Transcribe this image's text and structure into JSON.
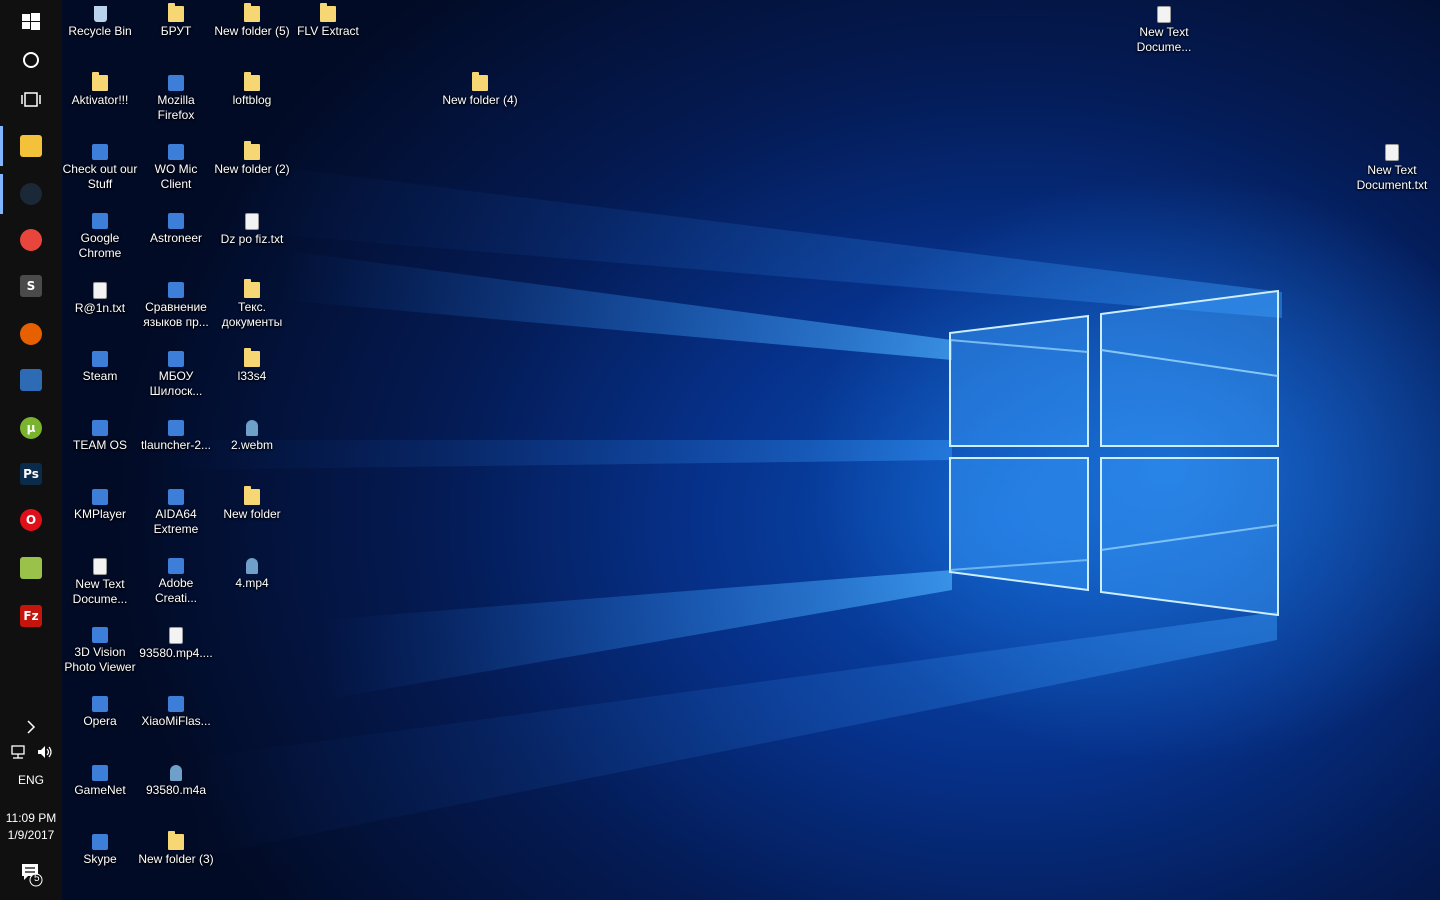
{
  "taskbar": {
    "start_icon": "windows-logo-icon",
    "search_icon": "cortana-circle-icon",
    "taskview_icon": "task-view-icon",
    "pinned": [
      {
        "name": "file-explorer",
        "icon": "folder-icon",
        "glyph": "",
        "color": "#f3c13a",
        "active": true
      },
      {
        "name": "steam",
        "icon": "steam-icon",
        "glyph": "",
        "color": "#1b2838",
        "active": true
      },
      {
        "name": "chrome",
        "icon": "chrome-icon",
        "glyph": "",
        "color": "#e8453c",
        "active": false
      },
      {
        "name": "sublime",
        "icon": "sublime-icon",
        "glyph": "S",
        "color": "#4a4a4a",
        "active": false
      },
      {
        "name": "firefox",
        "icon": "firefox-icon",
        "glyph": "",
        "color": "#e66000",
        "active": false
      },
      {
        "name": "movie-maker",
        "icon": "film-icon",
        "glyph": "",
        "color": "#2d6bb5",
        "active": false
      },
      {
        "name": "utorrent",
        "icon": "utorrent-icon",
        "glyph": "µ",
        "color": "#7ab32e",
        "active": false
      },
      {
        "name": "photoshop",
        "icon": "photoshop-icon",
        "glyph": "Ps",
        "color": "#0a2c4a",
        "active": false
      },
      {
        "name": "opera",
        "icon": "opera-icon",
        "glyph": "O",
        "color": "#e0101b",
        "active": false
      },
      {
        "name": "notepad",
        "icon": "notepad-icon",
        "glyph": "",
        "color": "#9ac14a",
        "active": false
      },
      {
        "name": "filezilla",
        "icon": "filezilla-icon",
        "glyph": "Fz",
        "color": "#c4140b",
        "active": false
      }
    ],
    "tray": {
      "chevron_icon": "chevron-right-icon",
      "network_icon": "network-icon",
      "volume_icon": "volume-icon",
      "language": "ENG",
      "time": "11:09 PM",
      "date": "1/9/2017",
      "notification_icon": "action-center-icon",
      "notification_count": "5"
    }
  },
  "desktop": {
    "icons": [
      {
        "label": "Recycle Bin",
        "kind": "recycle",
        "icon": "recycle-bin-icon"
      },
      {
        "label": "БРУТ",
        "kind": "folder",
        "icon": "folder-icon"
      },
      {
        "label": "New folder (5)",
        "kind": "folder",
        "icon": "folder-icon"
      },
      {
        "label": "FLV Extract",
        "kind": "folder",
        "icon": "folder-icon"
      },
      {
        "label": "New Text Docume...",
        "kind": "doc",
        "icon": "text-document-icon"
      },
      {
        "label": "Aktivator!!!",
        "kind": "folder",
        "icon": "folder-icon"
      },
      {
        "label": "Mozilla Firefox",
        "kind": "app",
        "icon": "firefox-shortcut-icon"
      },
      {
        "label": "loftblog",
        "kind": "folder",
        "icon": "folder-icon"
      },
      {
        "label": "New folder (4)",
        "kind": "folder",
        "icon": "folder-icon"
      },
      {
        "label": "Check out our Stuff",
        "kind": "app",
        "icon": "shortcut-icon"
      },
      {
        "label": "WO Mic Client",
        "kind": "app",
        "icon": "microphone-app-icon"
      },
      {
        "label": "New folder (2)",
        "kind": "folder",
        "icon": "folder-icon"
      },
      {
        "label": "New Text Document.txt",
        "kind": "doc",
        "icon": "text-document-icon"
      },
      {
        "label": "Google Chrome",
        "kind": "app",
        "icon": "chrome-shortcut-icon"
      },
      {
        "label": "Astroneer",
        "kind": "app",
        "icon": "astroneer-icon"
      },
      {
        "label": "Dz po fiz.txt",
        "kind": "doc",
        "icon": "text-document-icon"
      },
      {
        "label": "R@1n.txt",
        "kind": "doc",
        "icon": "text-document-icon"
      },
      {
        "label": "Сравнение языков пр...",
        "kind": "app",
        "icon": "pdf-icon"
      },
      {
        "label": "Текс. документы",
        "kind": "folder",
        "icon": "folder-icon"
      },
      {
        "label": "Steam",
        "kind": "app",
        "icon": "steam-shortcut-icon"
      },
      {
        "label": "МБОУ Шилоск...",
        "kind": "app",
        "icon": "word-document-icon"
      },
      {
        "label": "l33s4",
        "kind": "folder",
        "icon": "folder-icon"
      },
      {
        "label": "TEAM OS",
        "kind": "app",
        "icon": "shortcut-icon"
      },
      {
        "label": "tlauncher-2...",
        "kind": "app",
        "icon": "minecraft-icon"
      },
      {
        "label": "2.webm",
        "kind": "media",
        "icon": "vlc-media-icon"
      },
      {
        "label": "KMPlayer",
        "kind": "app",
        "icon": "kmplayer-icon"
      },
      {
        "label": "AIDA64 Extreme",
        "kind": "app",
        "icon": "aida64-icon"
      },
      {
        "label": "New folder",
        "kind": "folder",
        "icon": "folder-icon"
      },
      {
        "label": "New Text Docume...",
        "kind": "doc",
        "icon": "text-document-icon"
      },
      {
        "label": "Adobe Creati...",
        "kind": "app",
        "icon": "adobe-cc-icon"
      },
      {
        "label": "4.mp4",
        "kind": "media",
        "icon": "vlc-media-icon"
      },
      {
        "label": "3D Vision Photo Viewer",
        "kind": "app",
        "icon": "3d-vision-icon"
      },
      {
        "label": "93580.mp4....",
        "kind": "doc",
        "icon": "file-icon"
      },
      {
        "label": "Opera",
        "kind": "app",
        "icon": "opera-shortcut-icon"
      },
      {
        "label": "XiaoMiFlas...",
        "kind": "app",
        "icon": "xiaomi-flash-icon"
      },
      {
        "label": "GameNet",
        "kind": "app",
        "icon": "gamenet-icon"
      },
      {
        "label": "93580.m4a",
        "kind": "media",
        "icon": "vlc-media-icon"
      },
      {
        "label": "Skype",
        "kind": "app",
        "icon": "skype-icon"
      },
      {
        "label": "New folder (3)",
        "kind": "folder",
        "icon": "folder-icon"
      }
    ]
  },
  "wallpaper": {
    "name": "windows-10-hero-wallpaper",
    "accent": "#2e9bff"
  }
}
